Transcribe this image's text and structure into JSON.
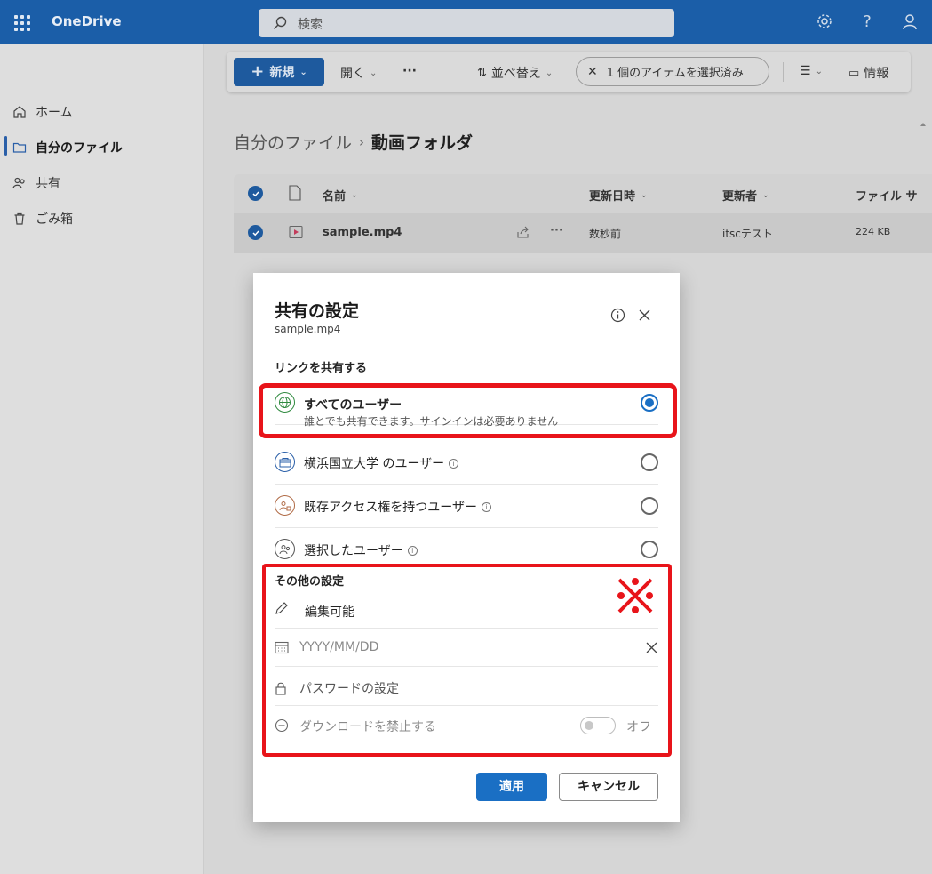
{
  "app": {
    "name": "OneDrive"
  },
  "search": {
    "placeholder": "検索"
  },
  "topbar": {
    "icons": [
      "settings-gear-icon",
      "help-question-icon",
      "user-person-icon"
    ]
  },
  "sidebar": {
    "items": [
      {
        "label": "ホーム",
        "icon": "home-icon"
      },
      {
        "label": "自分のファイル",
        "icon": "folder-icon",
        "active": true
      },
      {
        "label": "共有",
        "icon": "people-icon"
      },
      {
        "label": "ごみ箱",
        "icon": "trash-icon"
      }
    ]
  },
  "toolbar": {
    "new_label": "新規",
    "open_label": "開く",
    "more_label": "···",
    "sort_label": "並べ替え",
    "selection_label": "1 個のアイテムを選択済み",
    "info_label": "情報"
  },
  "breadcrumb": {
    "parent": "自分のファイル",
    "current": "動画フォルダ"
  },
  "file_list": {
    "headers": {
      "name": "名前",
      "modified": "更新日時",
      "modified_by": "更新者",
      "size": "ファイル サ"
    },
    "rows": [
      {
        "name": "sample.mp4",
        "modified": "数秒前",
        "modified_by": "itscテスト",
        "size": "224 KB",
        "selected": true
      }
    ]
  },
  "dialog": {
    "title": "共有の設定",
    "filename": "sample.mp4",
    "link_section_label": "リンクを共有する",
    "options": [
      {
        "label": "すべてのユーザー",
        "sub": "誰とでも共有できます。サインインは必要ありません",
        "selected": true,
        "icon": "globe-icon"
      },
      {
        "label": "横浜国立大学 のユーザー",
        "selected": false,
        "icon": "organization-icon"
      },
      {
        "label": "既存アクセス権を持つユーザー",
        "selected": false,
        "icon": "people-lock-icon"
      },
      {
        "label": "選択したユーザー",
        "selected": false,
        "icon": "people-select-icon"
      }
    ],
    "other_settings_label": "その他の設定",
    "edit_label": "編集可能",
    "date_placeholder": "YYYY/MM/DD",
    "password_label": "パスワードの設定",
    "block_download_label": "ダウンロードを禁止する",
    "toggle_state_label": "オフ",
    "apply_label": "適用",
    "cancel_label": "キャンセル"
  },
  "colors": {
    "highlight": "#e8141a",
    "accent": "#1a6fc4",
    "topbar": "#1b5ea8"
  }
}
